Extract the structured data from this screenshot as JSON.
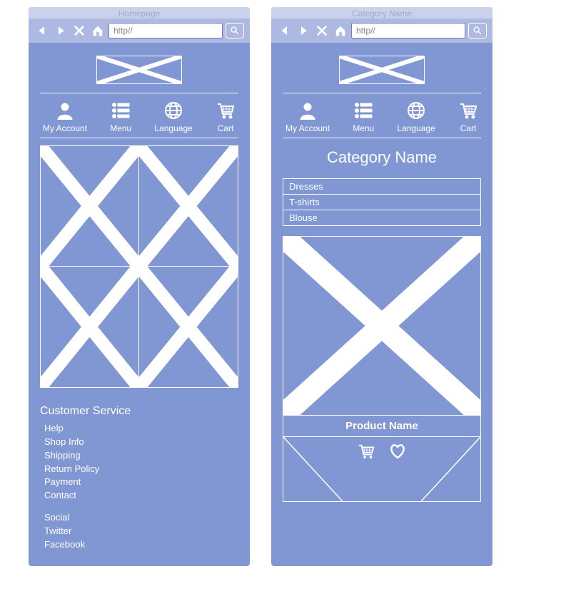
{
  "left": {
    "title": "Homepage",
    "url": "http//",
    "nav": {
      "account": "My Account",
      "menu": "Menu",
      "language": "Language",
      "cart": "Cart"
    },
    "cs_heading": "Customer Service",
    "links1": [
      "Help",
      "Shop Info",
      "Shipping",
      "Return Policy",
      "Payment",
      "Contact"
    ],
    "links2": [
      "Social",
      "Twitter",
      "Facebook"
    ]
  },
  "right": {
    "title": "Category Name",
    "url": "http//",
    "nav": {
      "account": "My Account",
      "menu": "Menu",
      "language": "Language",
      "cart": "Cart"
    },
    "page_heading": "Category Name",
    "categories": [
      "Dresses",
      "T-shirts",
      "Blouse"
    ],
    "product_name": "Product Name"
  }
}
